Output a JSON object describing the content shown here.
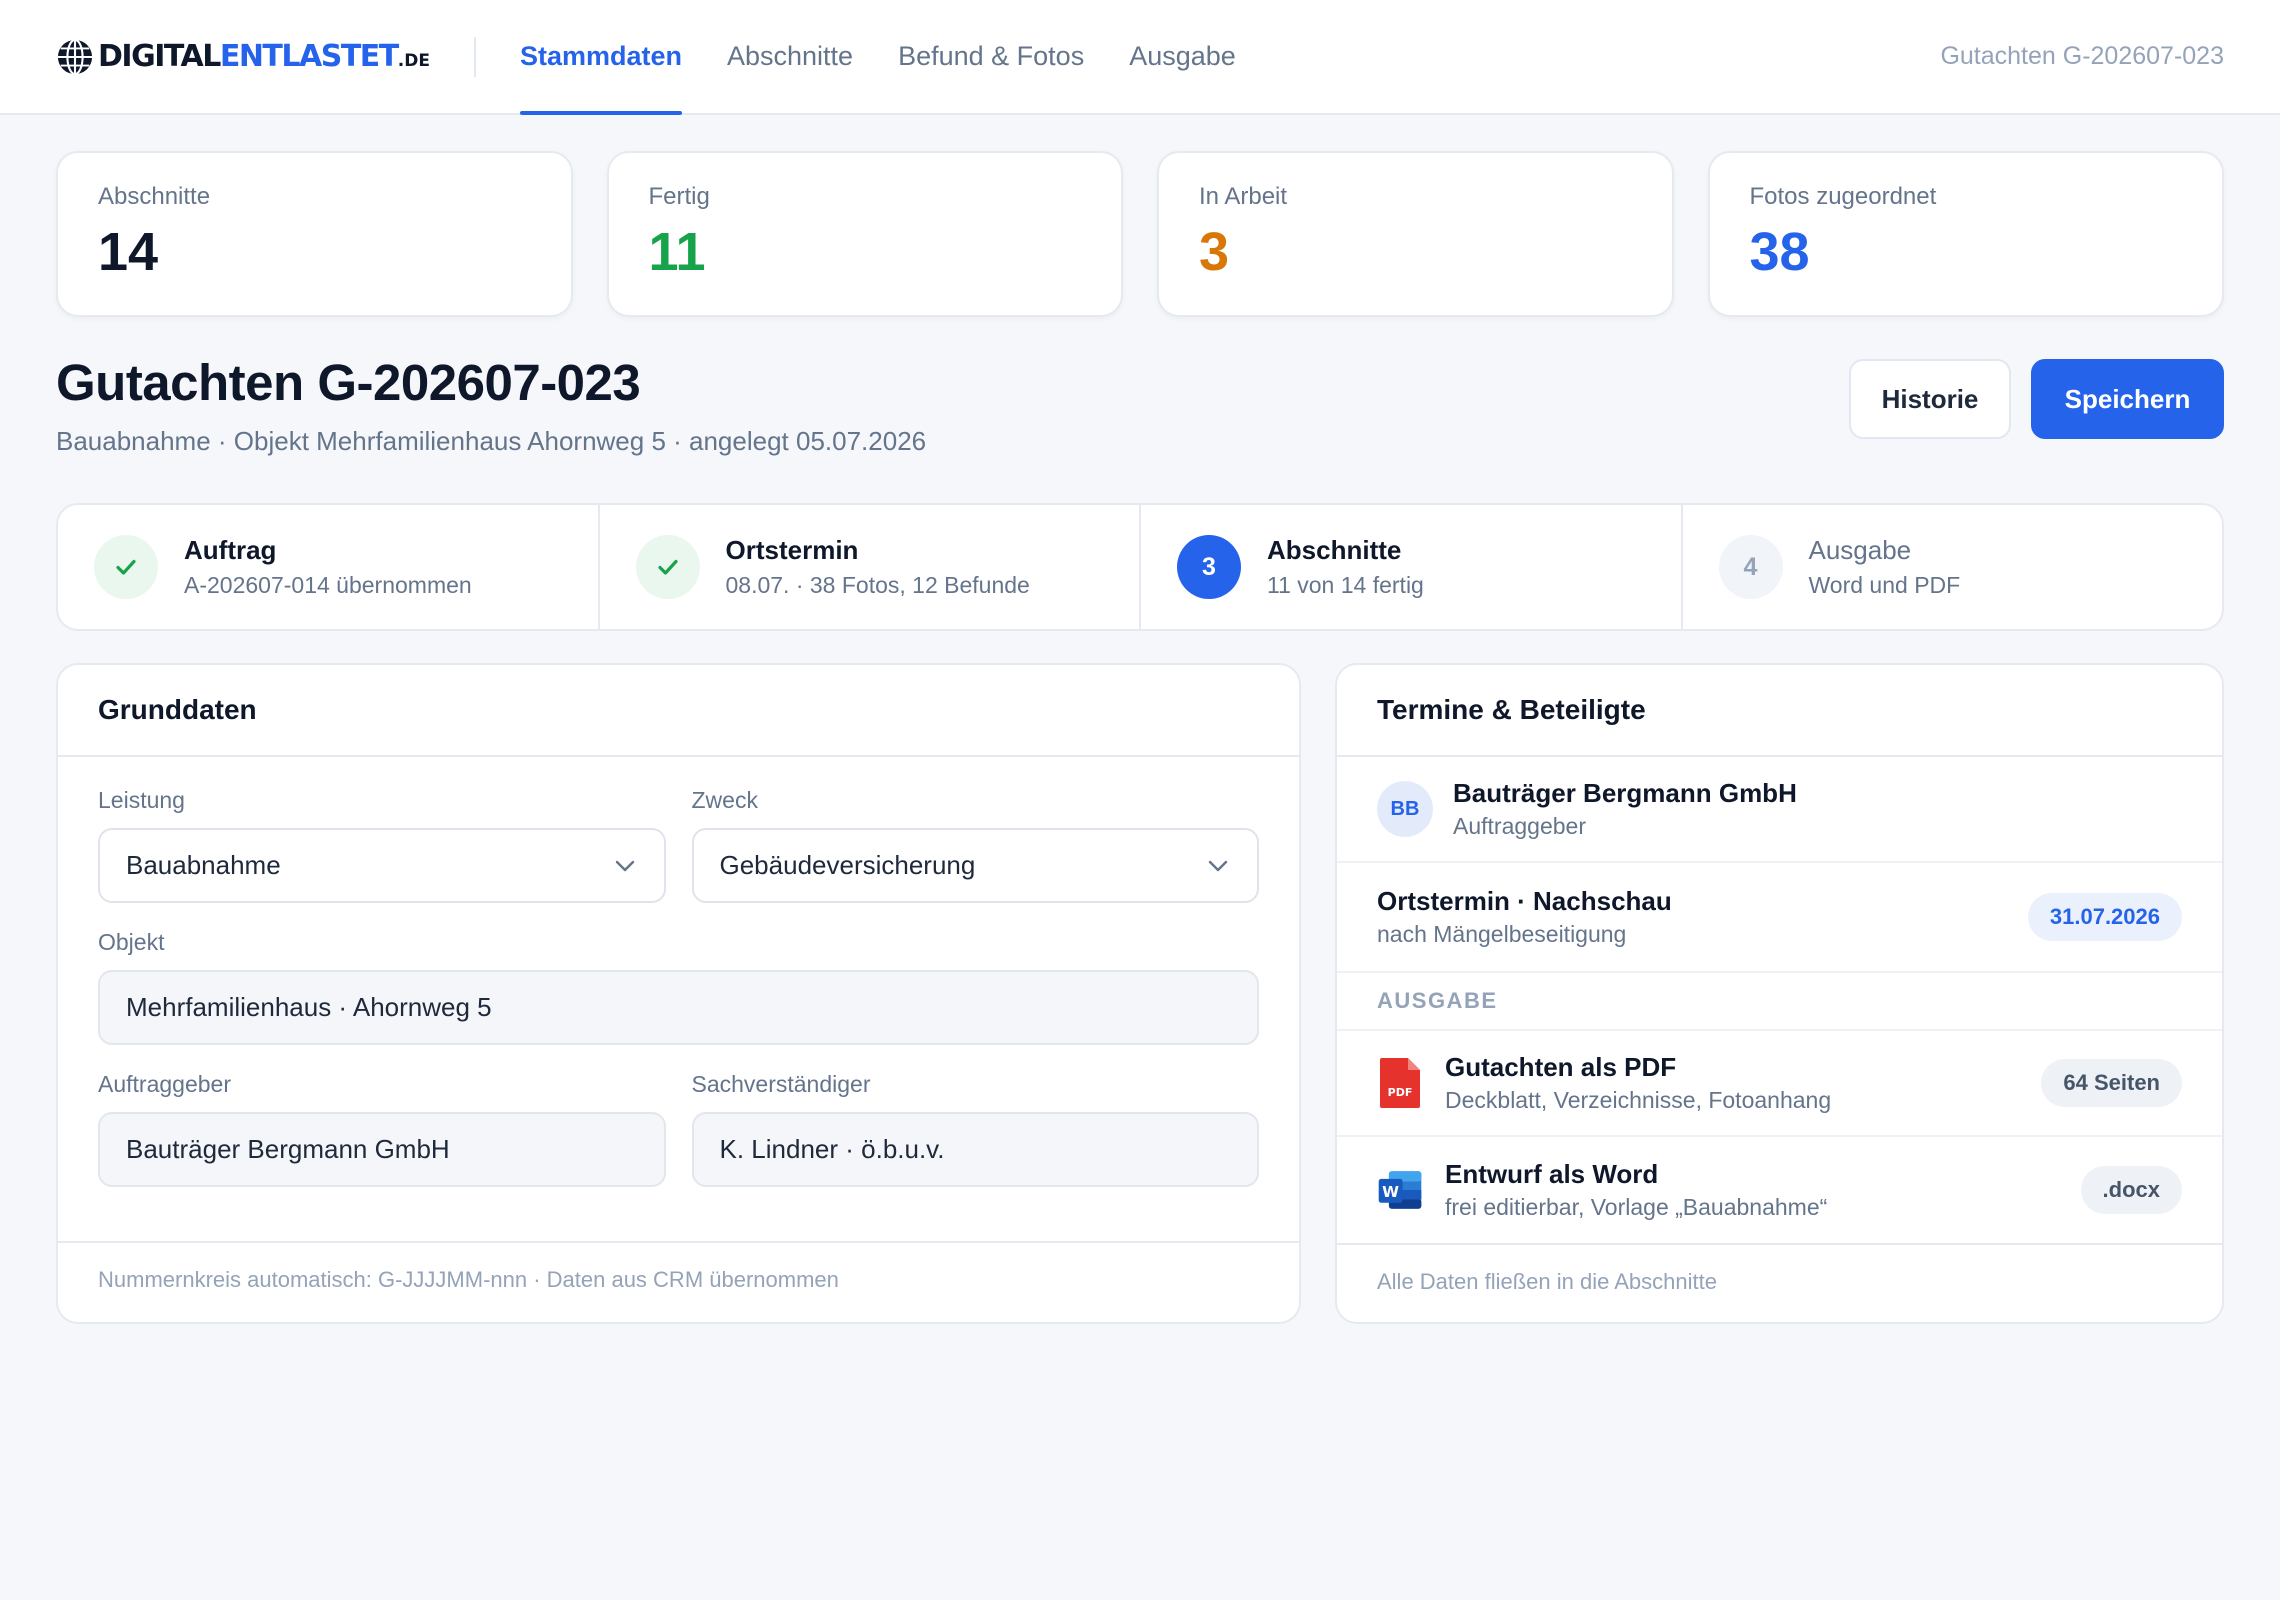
{
  "brand": {
    "name_part1": "DIGITAL",
    "name_part2": "ENTLASTET",
    "tld": ".DE"
  },
  "nav": {
    "tabs": [
      {
        "label": "Stammdaten",
        "active": true
      },
      {
        "label": "Abschnitte",
        "active": false
      },
      {
        "label": "Befund & Fotos",
        "active": false
      },
      {
        "label": "Ausgabe",
        "active": false
      }
    ],
    "doc_ref": "Gutachten G-202607-023"
  },
  "stats": [
    {
      "label": "Abschnitte",
      "value": "14",
      "color": "#0f172a"
    },
    {
      "label": "Fertig",
      "value": "11",
      "color": "#16a34a"
    },
    {
      "label": "In Arbeit",
      "value": "3",
      "color": "#d97706"
    },
    {
      "label": "Fotos zugeordnet",
      "value": "38",
      "color": "#2563eb"
    }
  ],
  "page": {
    "title": "Gutachten G-202607-023",
    "subtitle": "Bauabnahme · Objekt Mehrfamilienhaus Ahornweg 5 · angelegt 05.07.2026",
    "history_label": "Historie",
    "save_label": "Speichern"
  },
  "steps": [
    {
      "status": "done",
      "marker": "",
      "icon": "check-icon",
      "title": "Auftrag",
      "desc": "A-202607-014 übernommen"
    },
    {
      "status": "done",
      "marker": "",
      "icon": "check-icon",
      "title": "Ortstermin",
      "desc": "08.07. · 38 Fotos, 12 Befunde"
    },
    {
      "status": "current",
      "marker": "3",
      "title": "Abschnitte",
      "desc": "11 von 14 fertig"
    },
    {
      "status": "pending",
      "marker": "4",
      "title": "Ausgabe",
      "desc": "Word und PDF"
    }
  ],
  "grunddaten": {
    "title": "Grunddaten",
    "leistung": {
      "label": "Leistung",
      "value": "Bauabnahme"
    },
    "zweck": {
      "label": "Zweck",
      "value": "Gebäudeversicherung"
    },
    "objekt": {
      "label": "Objekt",
      "value": "Mehrfamilienhaus · Ahornweg 5"
    },
    "auftraggeber": {
      "label": "Auftraggeber",
      "value": "Bauträger Bergmann GmbH"
    },
    "sachverstaendiger": {
      "label": "Sachverständiger",
      "value": "K. Lindner · ö.b.u.v."
    },
    "footer": "Nummernkreis automatisch: G-JJJJMM-nnn · Daten aus CRM übernommen"
  },
  "termine": {
    "title": "Termine & Beteiligte",
    "party": {
      "initials": "BB",
      "name": "Bauträger Bergmann GmbH",
      "role": "Auftraggeber"
    },
    "appointment": {
      "title": "Ortstermin · Nachschau",
      "sub": "nach Mängelbeseitigung",
      "date": "31.07.2026"
    },
    "section_label": "AUSGABE",
    "files": [
      {
        "icon": "pdf-icon",
        "title": "Gutachten als PDF",
        "sub": "Deckblatt, Verzeichnisse, Fotoanhang",
        "badge": "64 Seiten"
      },
      {
        "icon": "word-icon",
        "title": "Entwurf als Word",
        "sub": "frei editierbar, Vorlage „Bauabnahme“",
        "badge": ".docx"
      }
    ],
    "footer": "Alle Daten fließen in die Abschnitte"
  }
}
